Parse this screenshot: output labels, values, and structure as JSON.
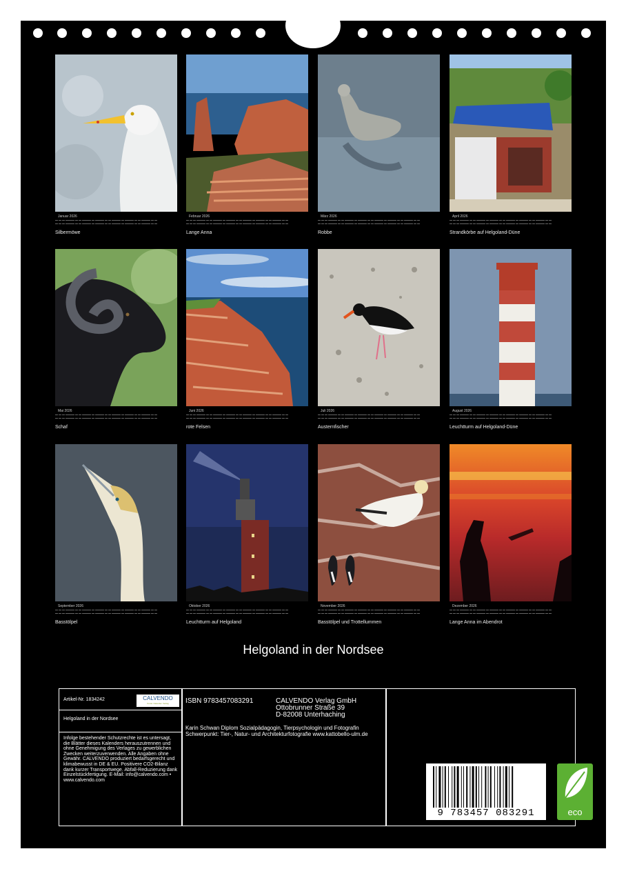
{
  "months": [
    {
      "label": "Januar 2026",
      "caption": "Silbermöwe"
    },
    {
      "label": "Februar 2026",
      "caption": "Lange Anna"
    },
    {
      "label": "März 2026",
      "caption": "Robbe"
    },
    {
      "label": "April 2026",
      "caption": "Strandkörbe auf Helgoland-Düne"
    },
    {
      "label": "Mai 2026",
      "caption": "Schaf"
    },
    {
      "label": "Juni 2026",
      "caption": "rote Felsen"
    },
    {
      "label": "Juli 2026",
      "caption": "Austernfischer"
    },
    {
      "label": "August 2026",
      "caption": "Leuchtturm auf Helgoland-Düne"
    },
    {
      "label": "September 2026",
      "caption": "Basstölpel"
    },
    {
      "label": "Oktober 2026",
      "caption": "Leuchtturm auf Helgoland"
    },
    {
      "label": "November 2026",
      "caption": "Basstölpel und Trottellummen"
    },
    {
      "label": "Dezember 2026",
      "caption": "Lange Anna im Abendrot"
    }
  ],
  "title": "Helgoland in der Nordsee",
  "footer": {
    "article": "Artikel-Nr.  1834242",
    "logo_text": "CALVENDO",
    "logo_sub": "Kunst. Kalender. Verlag",
    "calendar_title": "Helgoland in der Nordsee",
    "legal": "Infolge bestehender Schutzrechte ist es untersagt, die Blätter dieses Kalenders herauszutrennen und ohne Genehmigung des Verlages zu gewerblichen Zwecken weiterzuverwenden. Alle Angaben ohne Gewähr. CALVENDO produziert bedarfsgerecht und klimabewusst in DE & EU. Positivere CO2-Bilanz dank kurzer Transportwege. Abfall-Reduzierung dank Einzelstückfertigung. E-Mail: info@calvendo.com • www.calvendo.com",
    "isbn": "ISBN 9783457083291",
    "publisher_line1": "CALVENDO Verlag GmbH",
    "publisher_line2": "Ottobrunner Straße 39",
    "publisher_line3": "D-82008 Unterhaching",
    "author": "Karin Schwan Diplom Sozialpädagogin, Tierpsychologin und Fotografin Schwerpunkt: Tier-, Natur- und Architekturfotografie www.kattobello-ulm.de",
    "barcode_number": "9 783457 083291",
    "eco_label": "eco"
  }
}
